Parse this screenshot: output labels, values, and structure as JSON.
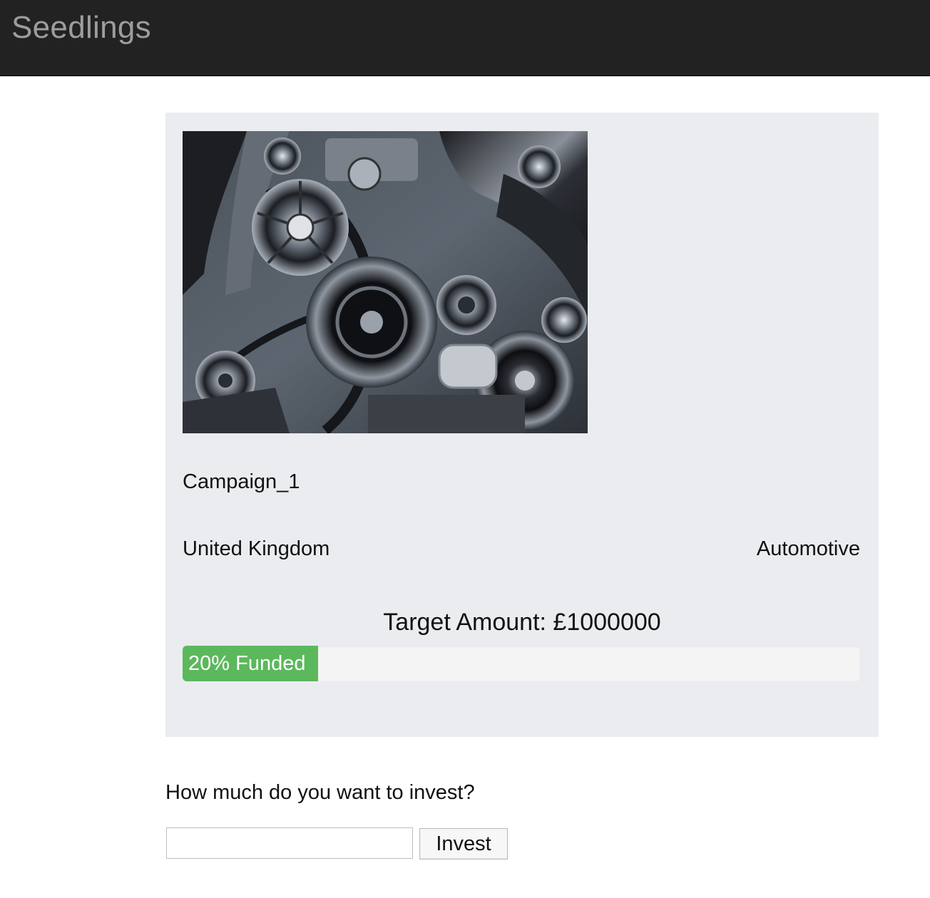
{
  "navbar": {
    "brand": "Seedlings"
  },
  "campaign": {
    "image_alt": "engine-image",
    "name": "Campaign_1",
    "country": "United Kingdom",
    "category": "Automotive",
    "target_label": "Target Amount: ",
    "target_value": "£1000000",
    "funded_percent": 20,
    "funded_label": "20% Funded"
  },
  "invest": {
    "question": "How much do you want to invest?",
    "input_value": "",
    "input_placeholder": "",
    "button_label": "Invest"
  },
  "colors": {
    "navbar": "#222222",
    "brand": "#9d9d9d",
    "card": "#ebecf0",
    "progress_fill": "#5cb85c",
    "progress_track": "#f4f4f4"
  }
}
